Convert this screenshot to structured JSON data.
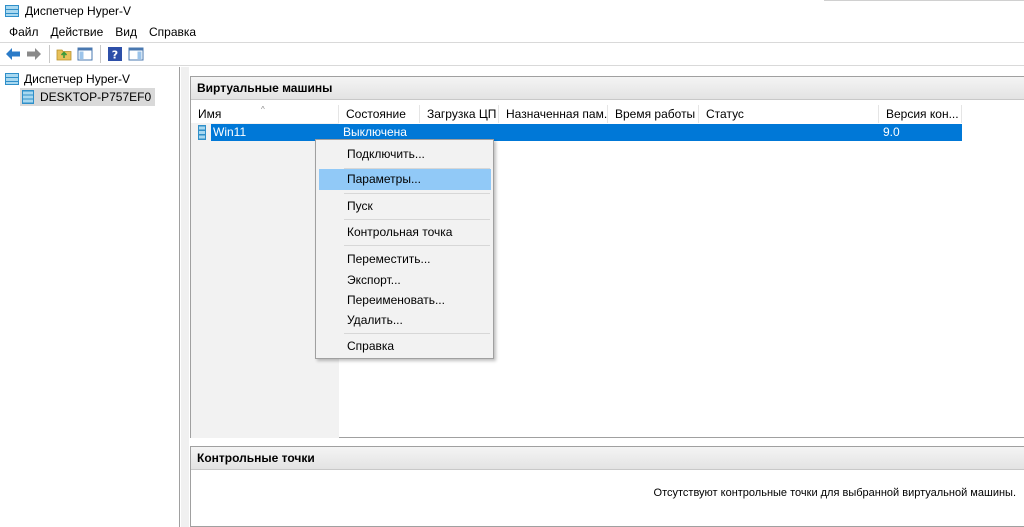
{
  "window": {
    "title": "Диспетчер Hyper-V"
  },
  "menu": [
    "Файл",
    "Действие",
    "Вид",
    "Справка"
  ],
  "toolbar": {
    "icons": [
      "back-arrow-icon",
      "forward-arrow-icon",
      "folder-up-icon",
      "show-hide-console-tree-icon",
      "help-icon",
      "action-pane-icon"
    ]
  },
  "tree": {
    "root": "Диспетчер Hyper-V",
    "server": "DESKTOP-P757EF0"
  },
  "vm_panel": {
    "title": "Виртуальные машины",
    "columns": [
      "Имя",
      "Состояние",
      "Загрузка ЦП",
      "Назначенная пам...",
      "Время работы",
      "Статус",
      "Версия кон..."
    ],
    "rows": [
      {
        "name": "Win11",
        "state": "Выключена",
        "cpu": "",
        "memory": "",
        "uptime": "",
        "status": "",
        "version": "9.0"
      }
    ]
  },
  "context_menu": {
    "items": [
      "Подключить...",
      "Параметры...",
      "Пуск",
      "Контрольная точка",
      "Переместить...",
      "Экспорт...",
      "Переименовать...",
      "Удалить...",
      "Справка"
    ],
    "highlighted": "Параметры..."
  },
  "checkpoints_panel": {
    "title": "Контрольные точки",
    "empty_text": "Отсутствуют контрольные точки для выбранной виртуальной машины."
  },
  "colors": {
    "selection": "#0078d7",
    "menu_highlight": "#91c9f7"
  }
}
